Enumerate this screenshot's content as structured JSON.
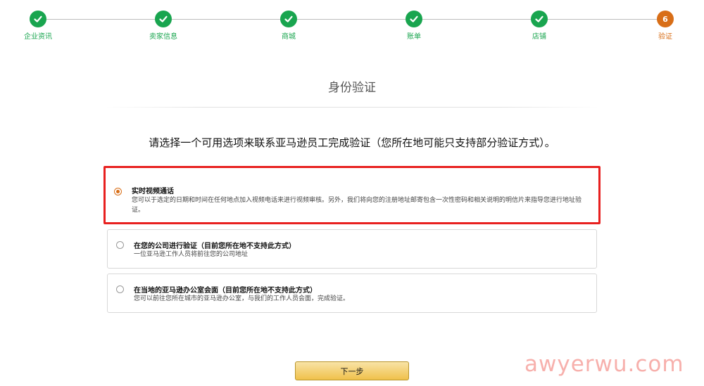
{
  "stepper": {
    "steps": [
      {
        "label": "企业资讯",
        "status": "done",
        "icon": "checkmark-icon"
      },
      {
        "label": "卖家信息",
        "status": "done",
        "icon": "checkmark-icon"
      },
      {
        "label": "商城",
        "status": "done",
        "icon": "checkmark-icon"
      },
      {
        "label": "账单",
        "status": "done",
        "icon": "checkmark-icon"
      },
      {
        "label": "店铺",
        "status": "done",
        "icon": "checkmark-icon"
      },
      {
        "label": "验证",
        "status": "current",
        "number": "6"
      }
    ],
    "colors": {
      "done": "#19a54f",
      "current": "#d86e17"
    }
  },
  "page": {
    "title": "身份验证",
    "instruction": "请选择一个可用选项来联系亚马逊员工完成验证（您所在地可能只支持部分验证方式）。"
  },
  "options": [
    {
      "title": "实时视频通话",
      "description": "您可以于选定的日期和时间在任何地点加入视频电话来进行视频审核。另外，我们将向您的注册地址邮寄包含一次性密码和相关说明的明信片来指导您进行地址验证。",
      "selected": true,
      "highlighted": true
    },
    {
      "title": "在您的公司进行验证（目前您所在地不支持此方式）",
      "description": "一位亚马逊工作人员将前往您的公司地址",
      "selected": false,
      "highlighted": false
    },
    {
      "title": "在当地的亚马逊办公室会面（目前您所在地不支持此方式）",
      "description": "您可以前往您所在城市的亚马逊办公室，与我们的工作人员会面，完成验证。",
      "selected": false,
      "highlighted": false
    }
  ],
  "next_button": {
    "label": "下一步"
  },
  "watermark": "awyerwu.com",
  "colors": {
    "highlight_border": "#e8201f",
    "button": "#f0c14b"
  }
}
